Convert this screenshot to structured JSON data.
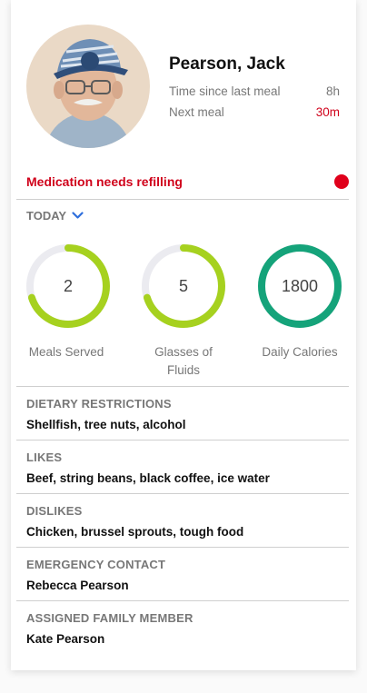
{
  "profile": {
    "name": "Pearson, Jack",
    "time_since_label": "Time since last meal",
    "time_since_value": "8h",
    "next_meal_label": "Next meal",
    "next_meal_value": "30m"
  },
  "alert": {
    "text": "Medication needs refilling",
    "dot_color": "#e0001b"
  },
  "period": {
    "label": "TODAY"
  },
  "metrics": [
    {
      "label": "Meals Served",
      "value": "2",
      "progress": 0.7,
      "color": "#a6d11f"
    },
    {
      "label": "Glasses of\nFluids",
      "value": "5",
      "progress": 0.7,
      "color": "#a6d11f"
    },
    {
      "label": "Daily Calories",
      "value": "1800",
      "progress": 1.0,
      "color": "#15a37a"
    }
  ],
  "sections": [
    {
      "heading": "DIETARY RESTRICTIONS",
      "value": "Shellfish, tree nuts, alcohol"
    },
    {
      "heading": "LIKES",
      "value": "Beef, string beans, black coffee, ice water"
    },
    {
      "heading": "DISLIKES",
      "value": "Chicken, brussel sprouts, tough food"
    },
    {
      "heading": "EMERGENCY CONTACT",
      "value": "Rebecca Pearson"
    },
    {
      "heading": "ASSIGNED FAMILY MEMBER",
      "value": "Kate Pearson"
    }
  ],
  "colors": {
    "accent_red": "#d0021b",
    "ring_track": "#ebebf0",
    "chevron_blue": "#2f6fdc"
  }
}
